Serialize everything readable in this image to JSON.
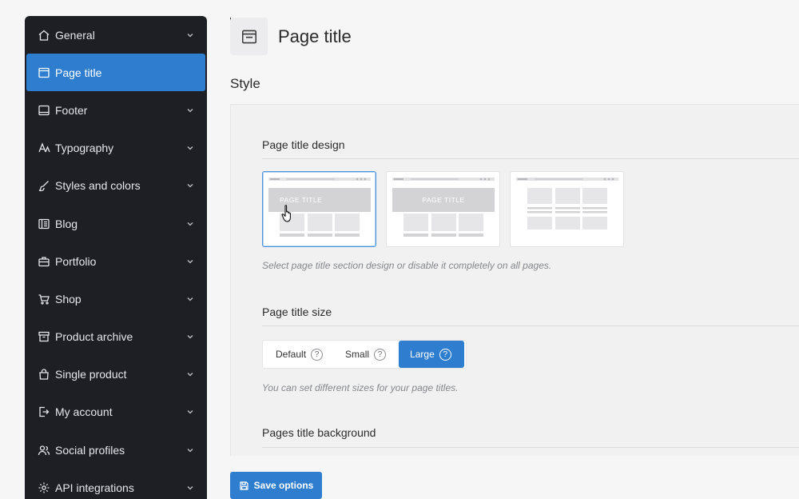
{
  "sidebar": {
    "items": [
      {
        "label": "General",
        "icon": "home-icon"
      },
      {
        "label": "Page title",
        "icon": "page-icon",
        "active": true
      },
      {
        "label": "Footer",
        "icon": "footer-icon"
      },
      {
        "label": "Typography",
        "icon": "typography-icon"
      },
      {
        "label": "Styles and colors",
        "icon": "brush-icon"
      },
      {
        "label": "Blog",
        "icon": "blog-icon"
      },
      {
        "label": "Portfolio",
        "icon": "briefcase-icon"
      },
      {
        "label": "Shop",
        "icon": "cart-icon"
      },
      {
        "label": "Product archive",
        "icon": "archive-icon"
      },
      {
        "label": "Single product",
        "icon": "bag-icon"
      },
      {
        "label": "My account",
        "icon": "login-icon"
      },
      {
        "label": "Social profiles",
        "icon": "users-icon"
      },
      {
        "label": "API integrations",
        "icon": "gear-icon"
      }
    ]
  },
  "header": {
    "title": "Page title"
  },
  "section": {
    "title": "Style"
  },
  "design": {
    "label": "Page title design",
    "options": [
      {
        "banner_text": "PAGE TITLE",
        "selected": true
      },
      {
        "banner_text": "PAGE TITLE",
        "selected": false
      },
      {
        "banner_text": "",
        "selected": false
      }
    ],
    "hint": "Select page title section design or disable it completely on all pages."
  },
  "size": {
    "label": "Page title size",
    "options": [
      {
        "label": "Default",
        "help": "?"
      },
      {
        "label": "Small",
        "help": "?"
      },
      {
        "label": "Large",
        "help": "?",
        "active": true
      }
    ],
    "hint": "You can set different sizes for your page titles."
  },
  "background": {
    "label": "Pages title background"
  },
  "save": {
    "label": "Save options"
  },
  "colors": {
    "accent": "#2f7dcf",
    "sidebar": "#1d1f24"
  }
}
